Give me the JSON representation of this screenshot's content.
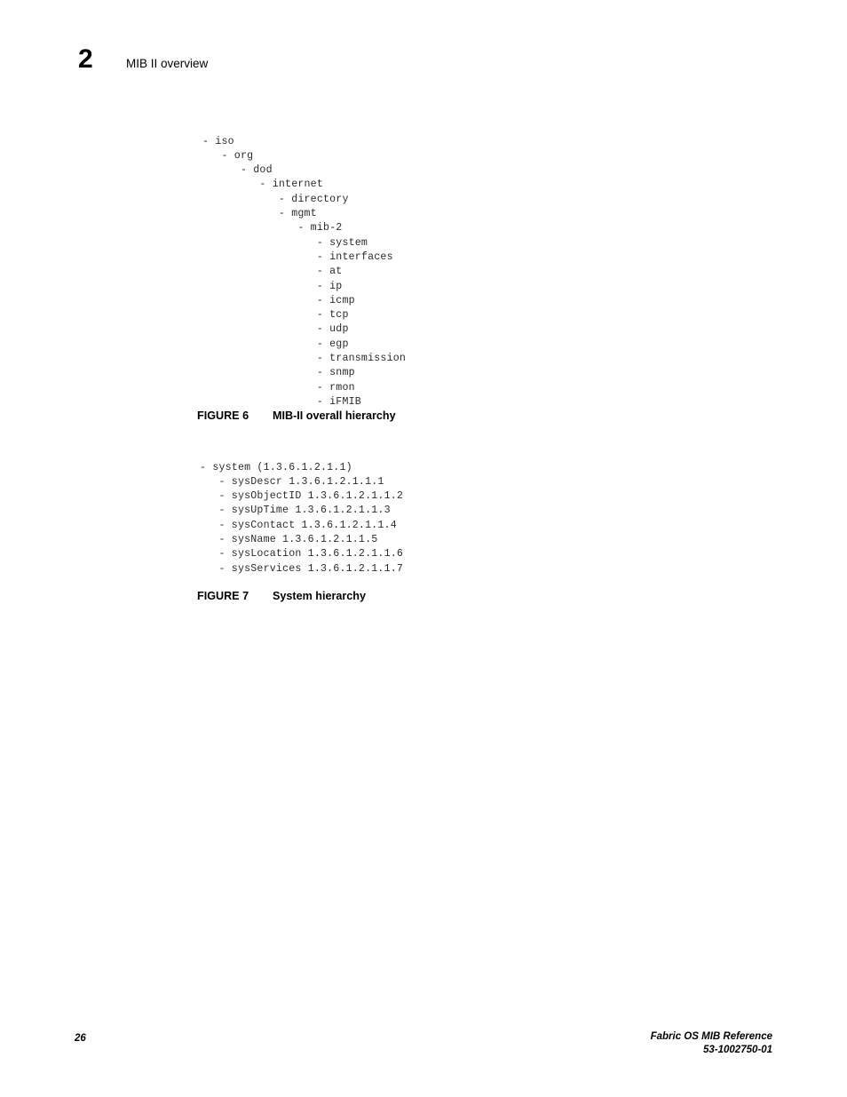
{
  "header": {
    "chapter_number": "2",
    "chapter_title": "MIB II overview"
  },
  "figures": [
    {
      "label": "FIGURE 6",
      "caption": "MIB-II overall hierarchy",
      "tree_lines": [
        "- iso",
        "   - org",
        "      - dod",
        "         - internet",
        "            - directory",
        "            - mgmt",
        "               - mib-2",
        "                  - system",
        "                  - interfaces",
        "                  - at",
        "                  - ip",
        "                  - icmp",
        "                  - tcp",
        "                  - udp",
        "                  - egp",
        "                  - transmission",
        "                  - snmp",
        "                  - rmon",
        "                  - iFMIB"
      ]
    },
    {
      "label": "FIGURE 7",
      "caption": "System hierarchy",
      "tree_lines": [
        "- system (1.3.6.1.2.1.1)",
        "   - sysDescr 1.3.6.1.2.1.1.1",
        "   - sysObjectID 1.3.6.1.2.1.1.2",
        "   - sysUpTime 1.3.6.1.2.1.1.3",
        "   - sysContact 1.3.6.1.2.1.1.4",
        "   - sysName 1.3.6.1.2.1.1.5",
        "   - sysLocation 1.3.6.1.2.1.1.6",
        "   - sysServices 1.3.6.1.2.1.1.7"
      ]
    }
  ],
  "footer": {
    "page_number": "26",
    "document_title": "Fabric OS MIB Reference",
    "document_part_number": "53-1002750-01"
  }
}
